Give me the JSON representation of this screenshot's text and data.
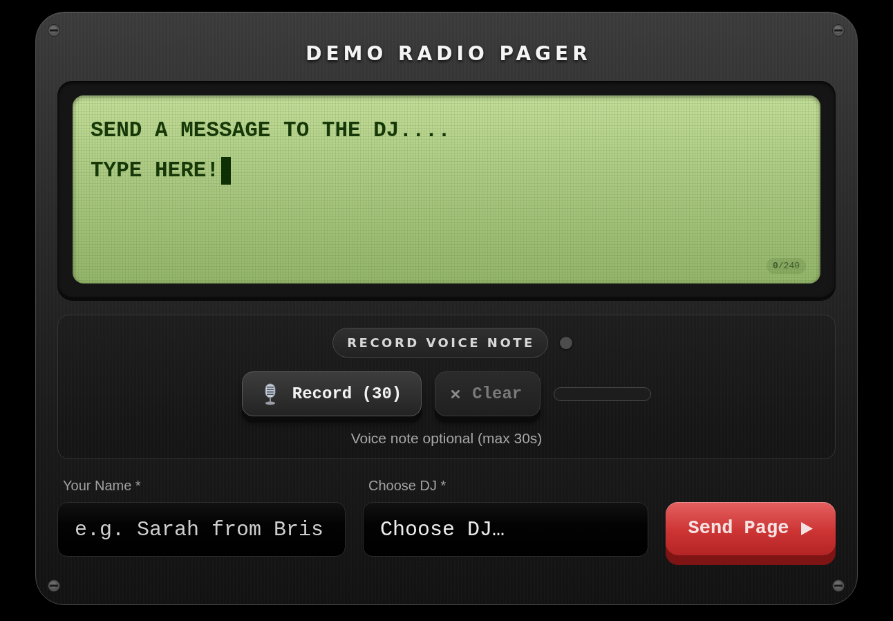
{
  "title": "DEMO RADIO PAGER",
  "message": {
    "placeholder_lines": [
      "SEND A MESSAGE TO THE DJ....",
      "TYPE HERE!"
    ],
    "counter": "**0**/240"
  },
  "voice_note": {
    "heading": "RECORD VOICE NOTE",
    "recording": false,
    "buttons": [
      {
        "kind": "record",
        "label": "Record (30)",
        "disabled": false
      },
      {
        "kind": "clear",
        "label": "Clear",
        "disabled": true
      }
    ],
    "progress": {
      "level": 0
    },
    "hint": "Voice note optional (max 30s)"
  },
  "form": {
    "fields": [
      {
        "kind": "text",
        "label": "Your Name *",
        "placeholder": "e.g. Sarah from Bris"
      },
      {
        "kind": "select",
        "label": "Choose DJ *",
        "value": "Choose DJ…"
      }
    ],
    "submit": {
      "label": "Send Page"
    }
  }
}
